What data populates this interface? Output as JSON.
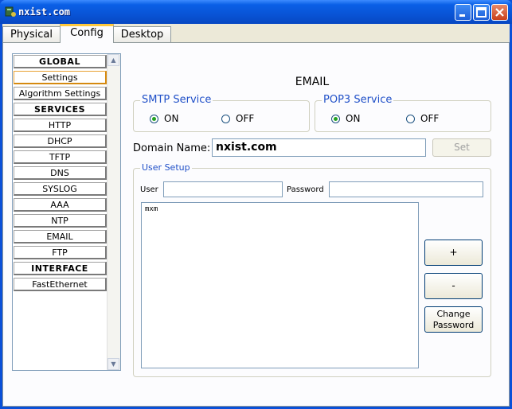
{
  "window": {
    "title": "nxist.com"
  },
  "tabs": [
    {
      "label": "Physical"
    },
    {
      "label": "Config"
    },
    {
      "label": "Desktop"
    }
  ],
  "sidebar": {
    "items": [
      {
        "label": "GLOBAL",
        "type": "header"
      },
      {
        "label": "Settings",
        "type": "item",
        "selected": true
      },
      {
        "label": "Algorithm Settings",
        "type": "item"
      },
      {
        "label": "SERVICES",
        "type": "header"
      },
      {
        "label": "HTTP",
        "type": "item"
      },
      {
        "label": "DHCP",
        "type": "item"
      },
      {
        "label": "TFTP",
        "type": "item"
      },
      {
        "label": "DNS",
        "type": "item"
      },
      {
        "label": "SYSLOG",
        "type": "item"
      },
      {
        "label": "AAA",
        "type": "item"
      },
      {
        "label": "NTP",
        "type": "item"
      },
      {
        "label": "EMAIL",
        "type": "item"
      },
      {
        "label": "FTP",
        "type": "item"
      },
      {
        "label": "INTERFACE",
        "type": "header"
      },
      {
        "label": "FastEthernet",
        "type": "item"
      }
    ]
  },
  "email": {
    "heading": "EMAIL",
    "smtp": {
      "legend": "SMTP Service",
      "on_label": "ON",
      "off_label": "OFF",
      "selected": "ON"
    },
    "pop3": {
      "legend": "POP3 Service",
      "on_label": "ON",
      "off_label": "OFF",
      "selected": "ON"
    },
    "domain": {
      "label": "Domain Name:",
      "value": "nxist.com",
      "set_label": "Set"
    },
    "user_setup": {
      "legend": "User Setup",
      "user_label": "User",
      "user_value": "",
      "password_label": "Password",
      "password_value": "",
      "users": [
        "mxm"
      ],
      "add_label": "+",
      "remove_label": "-",
      "change_password_label": "Change\nPassword"
    }
  },
  "colors": {
    "title_bar": "#0a5fe6",
    "legend_text": "#2050c8",
    "tab_active_accent": "#ffc83c"
  }
}
